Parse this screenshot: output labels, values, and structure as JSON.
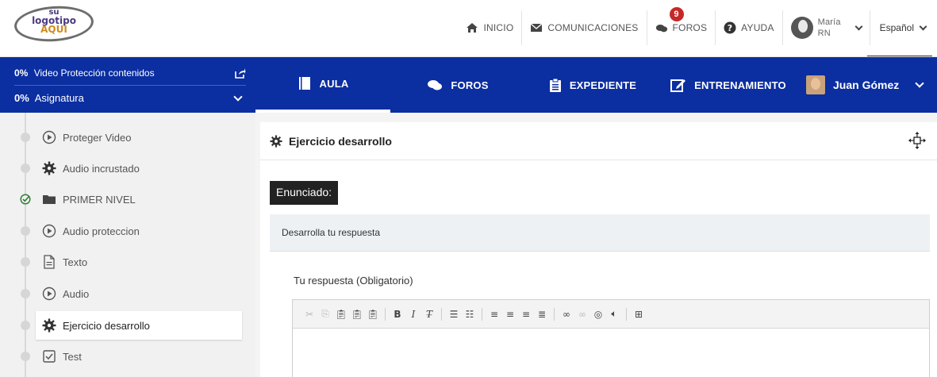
{
  "logo": {
    "line1": "su",
    "line2": "logotipo",
    "line3": "AQUÍ"
  },
  "topnav": {
    "home_label": "INICIO",
    "comms_label": "COMUNICACIONES",
    "forums_label": "FOROS",
    "forums_badge": "9",
    "help_label": "AYUDA",
    "user_first": "María",
    "user_last": "RN",
    "language": "Español"
  },
  "course": {
    "video_progress": "0%",
    "video_title": "Video Protección contenidos",
    "subject_progress": "0%",
    "subject_title": "Asignatura"
  },
  "tabs": [
    {
      "label": "AULA",
      "icon": "book-icon",
      "active": true
    },
    {
      "label": "FOROS",
      "icon": "chat-icon",
      "active": false
    },
    {
      "label": "EXPEDIENTE",
      "icon": "clipboard-icon",
      "active": false
    },
    {
      "label": "ENTRENAMIENTO",
      "icon": "edit-icon",
      "active": false
    }
  ],
  "tab_user": {
    "name": "Juan Gómez"
  },
  "sidebar": {
    "items": [
      {
        "label": "Proteger Video",
        "icon": "play-circle-icon",
        "status": "pending"
      },
      {
        "label": "Audio incrustado",
        "icon": "gear-icon",
        "status": "pending"
      },
      {
        "label": "PRIMER NIVEL",
        "icon": "folder-icon",
        "status": "completed"
      },
      {
        "label": "Audio proteccion",
        "icon": "play-circle-icon",
        "status": "pending"
      },
      {
        "label": "Texto",
        "icon": "document-icon",
        "status": "pending"
      },
      {
        "label": "Audio",
        "icon": "play-circle-icon",
        "status": "pending"
      },
      {
        "label": "Ejercicio desarrollo",
        "icon": "gear-icon",
        "status": "pending",
        "active": true
      },
      {
        "label": "Test",
        "icon": "checkbox-icon",
        "status": "pending"
      }
    ]
  },
  "main": {
    "title": "Ejercicio desarrollo",
    "statement_label": "Enunciado:",
    "statement_text": "Desarrolla tu respuesta",
    "response_label": "Tu respuesta (Obligatorio)"
  },
  "colors": {
    "brand_blue": "#0b2ea1",
    "badge_red": "#c62828",
    "completed_green": "#2e7d32"
  }
}
